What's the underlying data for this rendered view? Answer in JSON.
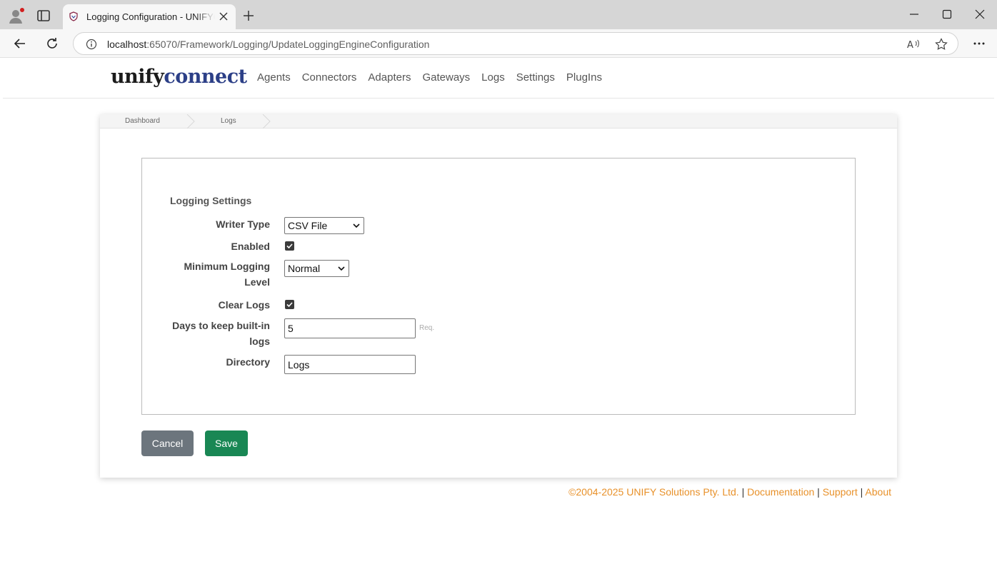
{
  "browser": {
    "tab_title": "Logging Configuration - UNIFYConnect",
    "url_host": "localhost",
    "url_rest": ":65070/Framework/Logging/UpdateLoggingEngineConfiguration"
  },
  "site": {
    "logo_part1": "unify",
    "logo_part2": "connect",
    "nav": [
      "Agents",
      "Connectors",
      "Adapters",
      "Gateways",
      "Logs",
      "Settings",
      "PlugIns"
    ]
  },
  "breadcrumb": [
    "Dashboard",
    "Logs"
  ],
  "form": {
    "legend": "Logging Settings",
    "writer_type_label": "Writer Type",
    "writer_type_value": "CSV File",
    "enabled_label": "Enabled",
    "enabled": true,
    "min_level_label_line1": "Minimum Logging",
    "min_level_label_line2": "Level",
    "min_level_value": "Normal",
    "clear_logs_label": "Clear Logs",
    "clear_logs": true,
    "days_label_line1": "Days to keep built-in",
    "days_label_line2": "logs",
    "days_value": "5",
    "days_req": "Req.",
    "directory_label": "Directory",
    "directory_value": "Logs"
  },
  "buttons": {
    "cancel": "Cancel",
    "save": "Save"
  },
  "footer": {
    "copyright": "©2004-2025 UNIFY Solutions Pty. Ltd.",
    "sep": "|",
    "documentation": "Documentation",
    "support": "Support",
    "about": "About"
  },
  "colors": {
    "accent_orange": "#e8912a",
    "save_green": "#198754",
    "cancel_gray": "#6c757d",
    "logo_blue": "#2c3f87"
  }
}
